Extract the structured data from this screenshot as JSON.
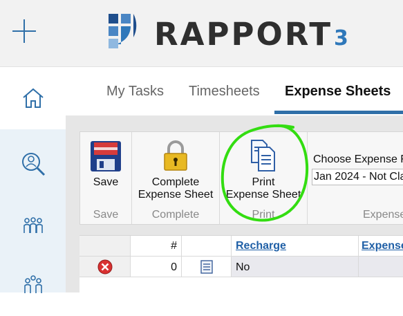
{
  "header": {
    "logo_text": "RAPPORT",
    "logo_version": "3"
  },
  "sidebar": {
    "items": [
      {
        "name": "home"
      },
      {
        "name": "search-person"
      },
      {
        "name": "team"
      },
      {
        "name": "team-2"
      }
    ]
  },
  "tabs": [
    {
      "label": "My Tasks"
    },
    {
      "label": "Timesheets"
    },
    {
      "label": "Expense Sheets",
      "active": true
    }
  ],
  "ribbon": {
    "save": {
      "button_label": "Save",
      "group_label": "Save"
    },
    "complete": {
      "button_label_line1": "Complete",
      "button_label_line2": "Expense Sheet",
      "group_label": "Complete"
    },
    "print": {
      "button_label_line1": "Print",
      "button_label_line2": "Expense Sheet",
      "group_label": "Print"
    },
    "choose": {
      "label": "Choose Expense F",
      "selected": "Jan 2024 - Not Cla",
      "group_label": "Expense"
    }
  },
  "table": {
    "headers": {
      "num": "#",
      "recharge": "Recharge",
      "expense": "Expense"
    },
    "rows": [
      {
        "num": "0",
        "recharge": "No"
      }
    ]
  },
  "colors": {
    "accent": "#2f6fa8",
    "highlight": "#33dd11"
  }
}
